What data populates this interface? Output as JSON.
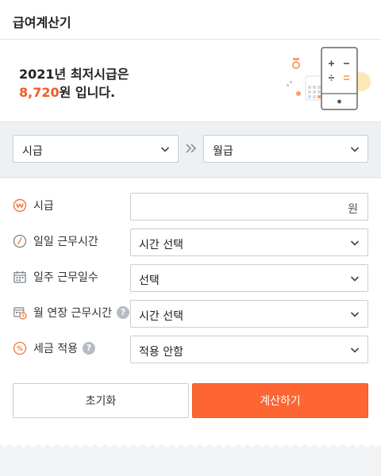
{
  "header": {
    "title": "급여계산기"
  },
  "banner": {
    "line1": "2021년 최저시급은",
    "min_wage": "8,720",
    "line2_suffix": "원 입니다."
  },
  "converter": {
    "from_unit": "시급",
    "to_unit": "월급",
    "arrow_icon": "double-chevron-right-icon"
  },
  "form": {
    "hourly_wage": {
      "label": "시급",
      "value": "",
      "unit": "원",
      "icon": "won-coin-icon"
    },
    "daily_hours": {
      "label": "일일 근무시간",
      "value": "시간 선택",
      "icon": "clock-icon"
    },
    "weekly_days": {
      "label": "일주 근무일수",
      "value": "선택",
      "icon": "calendar-icon"
    },
    "monthly_overtime": {
      "label": "월 연장 근무시간",
      "value": "시간 선택",
      "icon": "overtime-icon",
      "help": "?"
    },
    "tax": {
      "label": "세금 적용",
      "value": "적용 안함",
      "icon": "percent-icon",
      "help": "?"
    }
  },
  "buttons": {
    "reset": "초기화",
    "calculate": "계산하기"
  },
  "colors": {
    "accent": "#fd6533",
    "wage_highlight": "#f05a28",
    "border": "#c9ccd1",
    "band_bg": "#eef1f4"
  }
}
